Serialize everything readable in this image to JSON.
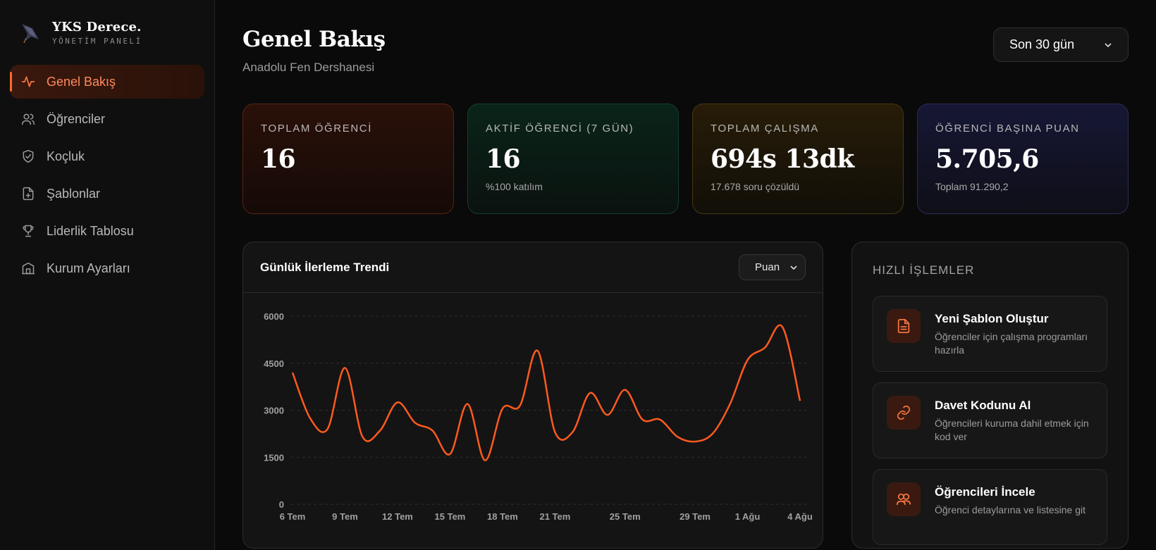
{
  "brand": {
    "title": "YKS Derece.",
    "subtitle": "YÖNETİM PANELİ"
  },
  "sidebar": {
    "items": [
      {
        "label": "Genel Bakış",
        "icon": "activity-icon",
        "active": true
      },
      {
        "label": "Öğrenciler",
        "icon": "users-icon",
        "active": false
      },
      {
        "label": "Koçluk",
        "icon": "shield-check-icon",
        "active": false
      },
      {
        "label": "Şablonlar",
        "icon": "file-plus-icon",
        "active": false
      },
      {
        "label": "Liderlik Tablosu",
        "icon": "trophy-icon",
        "active": false
      },
      {
        "label": "Kurum Ayarları",
        "icon": "building-icon",
        "active": false
      }
    ]
  },
  "header": {
    "title": "Genel Bakış",
    "subtitle": "Anadolu Fen Dershanesi",
    "range": "Son 30 gün"
  },
  "stats": [
    {
      "label": "TOPLAM ÖĞRENCİ",
      "value": "16",
      "note": ""
    },
    {
      "label": "AKTİF ÖĞRENCİ (7 GÜN)",
      "value": "16",
      "note": "%100 katılım"
    },
    {
      "label": "TOPLAM ÇALIŞMA",
      "value": "694s 13dk",
      "note": "17.678 soru çözüldü"
    },
    {
      "label": "ÖĞRENCİ BAŞINA PUAN",
      "value": "5.705,6",
      "note": "Toplam 91.290,2"
    }
  ],
  "chart_card": {
    "title": "Günlük İlerleme Trendi",
    "metric": "Puan"
  },
  "chart_data": {
    "type": "line",
    "ylim": [
      0,
      6000
    ],
    "yticks": [
      0,
      1500,
      3000,
      4500,
      6000
    ],
    "xtick_labels": [
      "6 Tem",
      "9 Tem",
      "12 Tem",
      "15 Tem",
      "18 Tem",
      "21 Tem",
      "25 Tem",
      "29 Tem",
      "1 Ağu",
      "4 Ağu"
    ],
    "xtick_days": [
      0,
      3,
      6,
      9,
      12,
      15,
      19,
      23,
      26,
      29
    ],
    "x_days": [
      0,
      1,
      2,
      3,
      4,
      5,
      6,
      7,
      8,
      9,
      10,
      11,
      12,
      13,
      14,
      15,
      16,
      17,
      18,
      19,
      20,
      21,
      22,
      23,
      24,
      25,
      26,
      27,
      28,
      29
    ],
    "values": [
      4200,
      2750,
      2400,
      4350,
      2150,
      2350,
      3250,
      2600,
      2350,
      1600,
      3200,
      1400,
      3050,
      3150,
      4900,
      2300,
      2300,
      3550,
      2850,
      3650,
      2700,
      2700,
      2150,
      2000,
      2250,
      3200,
      4600,
      5000,
      5650,
      3300
    ],
    "color": "#ff5a1f"
  },
  "quick_actions": {
    "title": "HIZLI İŞLEMLER",
    "items": [
      {
        "title": "Yeni Şablon Oluştur",
        "desc": "Öğrenciler için çalışma programları hazırla",
        "icon": "document-icon"
      },
      {
        "title": "Davet Kodunu Al",
        "desc": "Öğrencileri kuruma dahil etmek için kod ver",
        "icon": "link-icon"
      },
      {
        "title": "Öğrencileri İncele",
        "desc": "Öğrenci detaylarına ve listesine git",
        "icon": "users-icon"
      }
    ]
  }
}
